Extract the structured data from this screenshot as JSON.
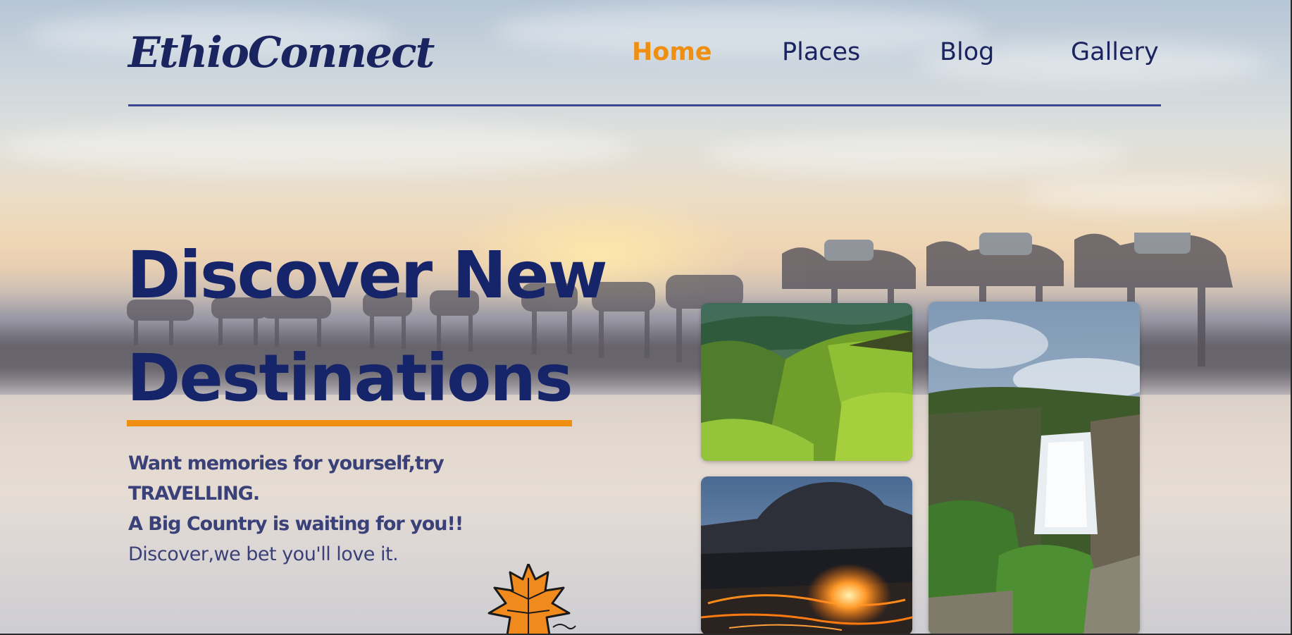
{
  "brand": {
    "logo_text": "EthioConnect"
  },
  "nav": {
    "items": [
      {
        "label": "Home",
        "active": true
      },
      {
        "label": "Places",
        "active": false
      },
      {
        "label": "Blog",
        "active": false
      },
      {
        "label": "Gallery",
        "active": false
      }
    ]
  },
  "hero": {
    "headline_line1": "Discover New",
    "headline_line2": "Destinations",
    "tagline_line1": "Want memories for yourself,try",
    "tagline_line2": "TRAVELLING.",
    "tagline_line3": "A Big Country is waiting for you!!",
    "tagline_line4": "Discover,we bet you'll love it."
  },
  "gallery": {
    "photos": [
      {
        "subject": "green-highlands-valley"
      },
      {
        "subject": "lava-lake-volcano"
      },
      {
        "subject": "waterfall-cliffs"
      }
    ]
  },
  "colors": {
    "brand_navy": "#16246a",
    "accent_orange": "#ef8f12",
    "text_muted": "#3a4178",
    "nav_rule": "#3b4590"
  },
  "icons": {
    "decor": "maple-leaf-icon"
  }
}
